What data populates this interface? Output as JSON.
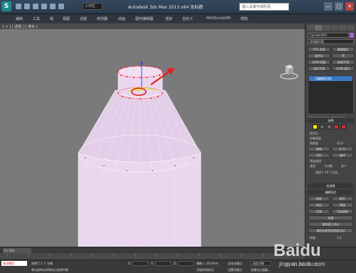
{
  "app": {
    "logo_letter": "S",
    "workspace": "工作区",
    "title": "Autodesk 3ds Max 2013 x64   无标题",
    "search_placeholder": "键入关键字或短语",
    "window_buttons": [
      "—",
      "□",
      "✕"
    ]
  },
  "menu": [
    "编辑",
    "工具",
    "组",
    "视图",
    "创建",
    "修改器",
    "动画",
    "图形编辑器",
    "渲染",
    "自定义",
    "MAXScript(M)",
    "帮助"
  ],
  "viewport": {
    "label": "[ + ] [ 透视 ] [ 真实 ]"
  },
  "command_panel": {
    "object_name": "Cylinder001",
    "modifier_list_label": "修改器列表",
    "buttons_row1": [
      "FFD 选择",
      "编辑面片"
    ],
    "buttons_row2": [
      "面挤出",
      "壳"
    ],
    "buttons_row3": [
      "UVW 贴图",
      "网格平滑"
    ],
    "buttons_row4": [
      "涡轮平滑",
      "UVW 展开"
    ],
    "stack_item": "可编辑多边形",
    "section_selection": "选择",
    "checkbox_back": "按顶点",
    "checkbox_ignore": "忽略背面",
    "checkbox_angle": "按角度",
    "angle_value": "45.0",
    "shrink": "收缩",
    "grow": "扩大",
    "ring": "环形",
    "loop": "循环",
    "preview_label": "预览选择",
    "preview_off": "禁用",
    "preview_subobj": "子对象",
    "preview_multi": "多个",
    "selected_count": "选择了 16 个顶点",
    "section_soft": "软选择",
    "section_edit_vertex": "编辑顶点",
    "remove": "移除",
    "break": "断开",
    "extrude": "挤出",
    "weld": "焊接",
    "chamfer": "切角",
    "target_weld": "目标焊接",
    "connect": "连接",
    "remove_isolated": "移除孤立顶点",
    "remove_unused_map": "移除未使用的贴图顶点",
    "weight_label": "权重:",
    "weight_value": "1.0"
  },
  "timeline": {
    "slider": "0 / 100"
  },
  "status": {
    "maxscript": "欢迎使用",
    "selected": "选择了 1 个 对象",
    "hint": "单击或单击并拖动以选择对象",
    "x_label": "X:",
    "y_label": "Y:",
    "z_label": "Z:",
    "grid": "栅格 = 10.0mm",
    "auto_key": "自动关键点",
    "selected_obj": "选定对象",
    "set_key": "设置关键点",
    "key_filter": "关键点过滤器...",
    "add_time_tag": "添加时间标记"
  },
  "watermark": {
    "brand": "Baidu",
    "sub": "jingyan.baidu.com"
  },
  "colors": {
    "accent_blue": "#3c78c8",
    "bottle_fill": "#ead6ee",
    "vertex_red": "#ff2020",
    "arrow_red": "#e02020"
  }
}
